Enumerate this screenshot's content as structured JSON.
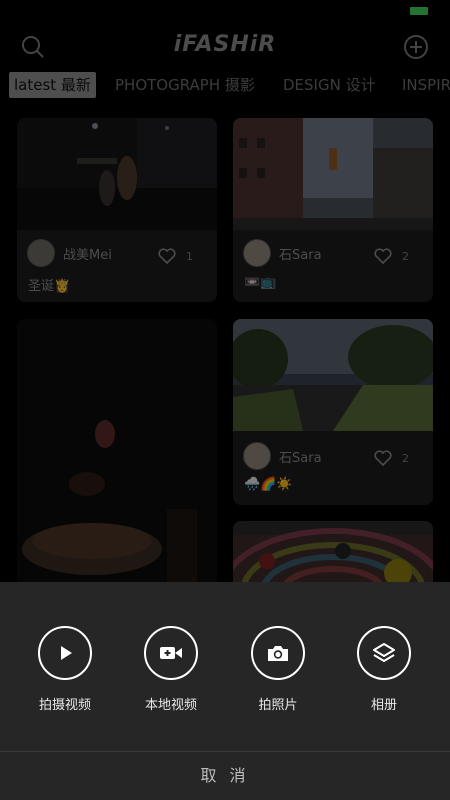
{
  "header": {
    "logo": "iFASHiR",
    "search_icon": "search-icon",
    "add_icon": "add-circle-icon"
  },
  "tabs": [
    {
      "label": "latest 最新",
      "active": true
    },
    {
      "label": "PHOTOGRAPH 摄影",
      "active": false
    },
    {
      "label": "DESIGN 设计",
      "active": false
    },
    {
      "label": "INSPIR",
      "active": false
    }
  ],
  "feed": {
    "cards": [
      {
        "author": "战美Mei",
        "likes": "1",
        "caption": "圣诞👸"
      },
      {
        "author": "石Sara",
        "likes": "2",
        "caption": "📼📺"
      },
      {
        "author": "石Sara",
        "likes": "2",
        "caption": "🌧️🌈☀️"
      }
    ]
  },
  "action_sheet": {
    "actions": [
      {
        "label": "拍摄视频",
        "icon": "play-icon"
      },
      {
        "label": "本地视频",
        "icon": "video-camera-icon"
      },
      {
        "label": "拍照片",
        "icon": "camera-icon"
      },
      {
        "label": "相册",
        "icon": "layers-icon"
      }
    ],
    "cancel_label": "取 消"
  },
  "colors": {
    "background": "#000000",
    "card": "#1d1d1d",
    "sheet": "#262626",
    "battery": "#41d35c"
  }
}
